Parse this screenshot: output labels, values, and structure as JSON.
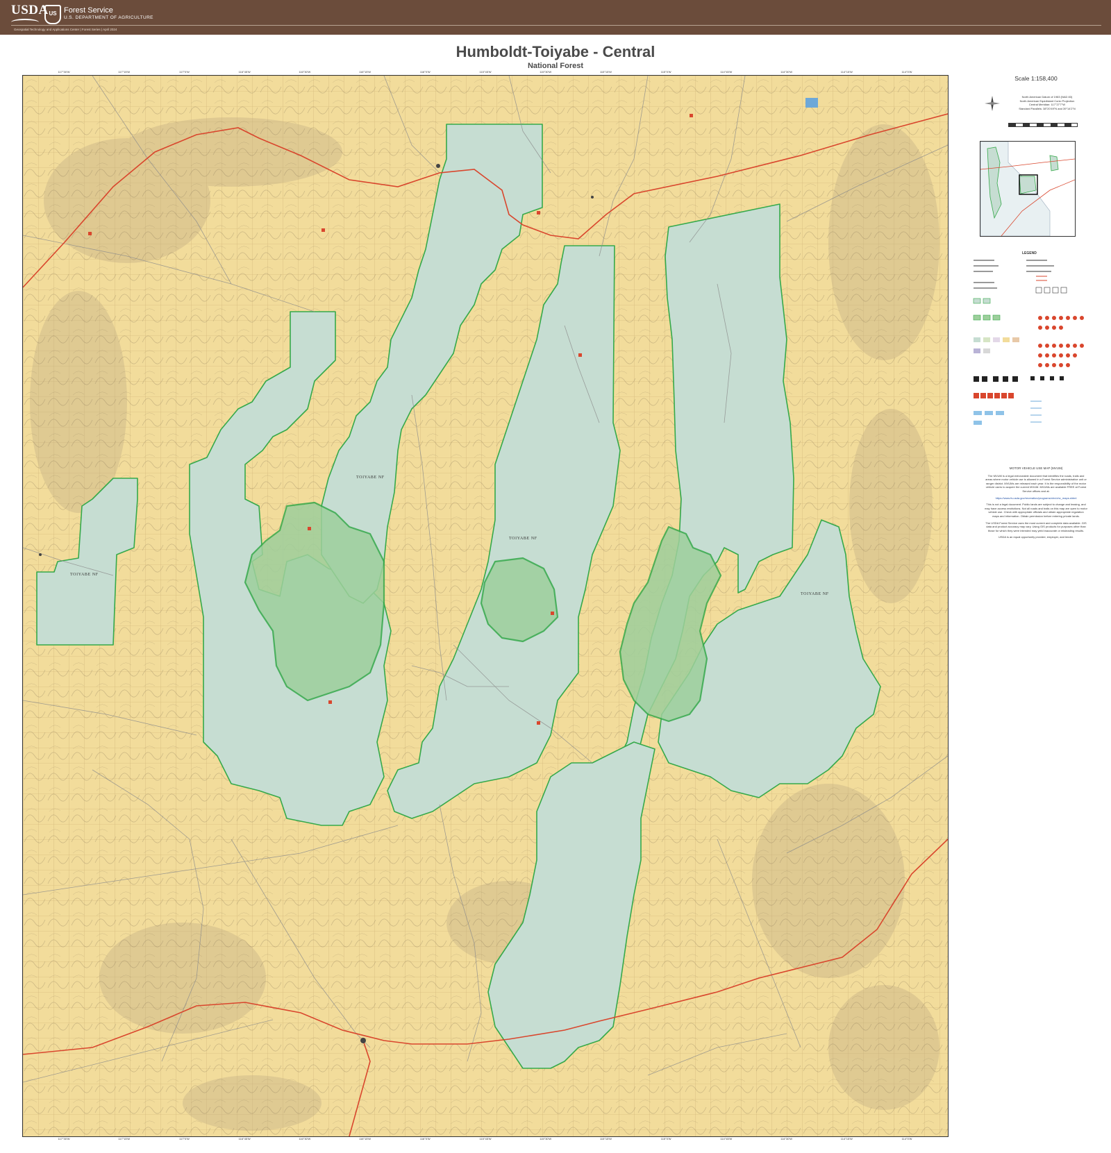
{
  "header": {
    "usda": "USDA",
    "shield_letters": "US",
    "agency": "Forest Service",
    "department": "U.S. DEPARTMENT OF AGRICULTURE",
    "credit": "Geospatial Technology and Applications Center | Forest Series | April 2024"
  },
  "map": {
    "title": "Humboldt-Toiyabe - Central",
    "subtitle": "National Forest",
    "scale": "Scale 1:158,400",
    "area_labels": [
      "TOIYABE NF",
      "TOIYABE NF",
      "TOIYABE NF",
      "TOIYABE NF"
    ],
    "colors": {
      "forest": "#c6ddd2",
      "wilderness": "#9ecf9c",
      "boundary": "#35a94a",
      "private_land": "#f2dc9b",
      "highway": "#d9462d",
      "road": "#8b8b8b",
      "grid": "#c7a96e"
    },
    "top_ticks": [
      "117°30'W",
      "117°15'W",
      "117°0'W",
      "116°45'W",
      "116°30'W",
      "116°15'W",
      "116°0'W",
      "115°45'W",
      "115°30'W",
      "115°15'W",
      "115°0'W",
      "114°45'W",
      "114°30'W",
      "114°15'W",
      "114°0'W"
    ],
    "bottom_ticks": [
      "117°30'W",
      "117°15'W",
      "117°0'W",
      "116°45'W",
      "116°30'W",
      "116°15'W",
      "116°0'W",
      "115°45'W",
      "115°30'W",
      "115°15'W",
      "115°0'W",
      "114°45'W",
      "114°30'W",
      "114°15'W",
      "114°0'W"
    ]
  },
  "sidebar": {
    "projection": [
      "North American Datum of 1983 (NAD 83)",
      "North American Equidistant Conic Projection",
      "Central Meridian: 117°27'7\"W",
      "Standard Parallels: 38°20'49\"N and 39°14'2\"N"
    ],
    "legend_title": "LEGEND",
    "mvum_title": "MOTOR VEHICLE USE MAP (MVUM)",
    "mvum_paragraphs": [
      "The MVUM is a legal enforceable document that identifies the roads, trails and areas where motor vehicle use is allowed in a Forest Service administrative unit or ranger district. MVUMs are released each year. It is the responsibility of the motor vehicle users to acquire the current MVUM. MVUMs are available FREE at Forest Service offices and at:",
      "This is not a legal document. Public lands are subject to change and leasing, and may have access restrictions. Not all roads and trails on this map are open to motor vehicle use. Check with appropriate officials and obtain appropriate regulation maps and information. Obtain permission before entering private lands.",
      "The USDA Forest Service uses the most current and complete data available. GIS data and product accuracy may vary. Using GIS products for purposes other than those for which they were intended may yield inaccurate or misleading results.",
      "USDA is an equal opportunity provider, employer, and lender."
    ],
    "mvum_link": "https://www.fs.usda.gov/recreation/programs/ohv/ohv_maps.shtml"
  }
}
